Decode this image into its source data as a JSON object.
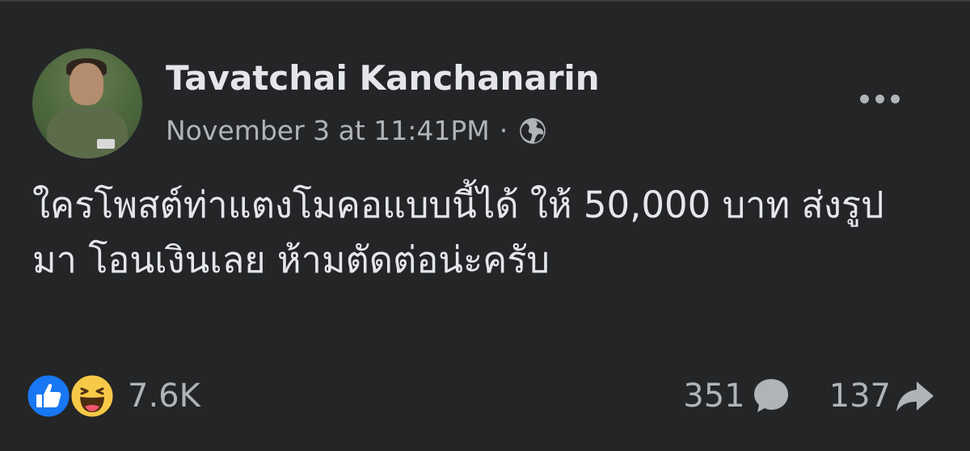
{
  "post": {
    "author": "Tavatchai Kanchanarin",
    "timestamp": "November 3 at 11:41PM",
    "separator": "·",
    "privacy_icon": "globe-icon",
    "more_icon": "more-options-icon",
    "text_lines": [
      "ใครโพสต์ท่าแตงโมคอแบบนี้ได้ ให้ 50,000 บาท ส่งรูป",
      "มา โอนเงินเลย ห้ามตัดต่อน่ะครับ"
    ],
    "reactions": {
      "icons": [
        "like-icon",
        "haha-icon"
      ],
      "count": "7.6K"
    },
    "comments_count": "351",
    "shares_count": "137"
  },
  "colors": {
    "background": "#242526",
    "primary_text": "#e4e6eb",
    "secondary_text": "#b0b3b8",
    "like_blue": "#1877f2",
    "haha_yellow": "#f7c948"
  }
}
